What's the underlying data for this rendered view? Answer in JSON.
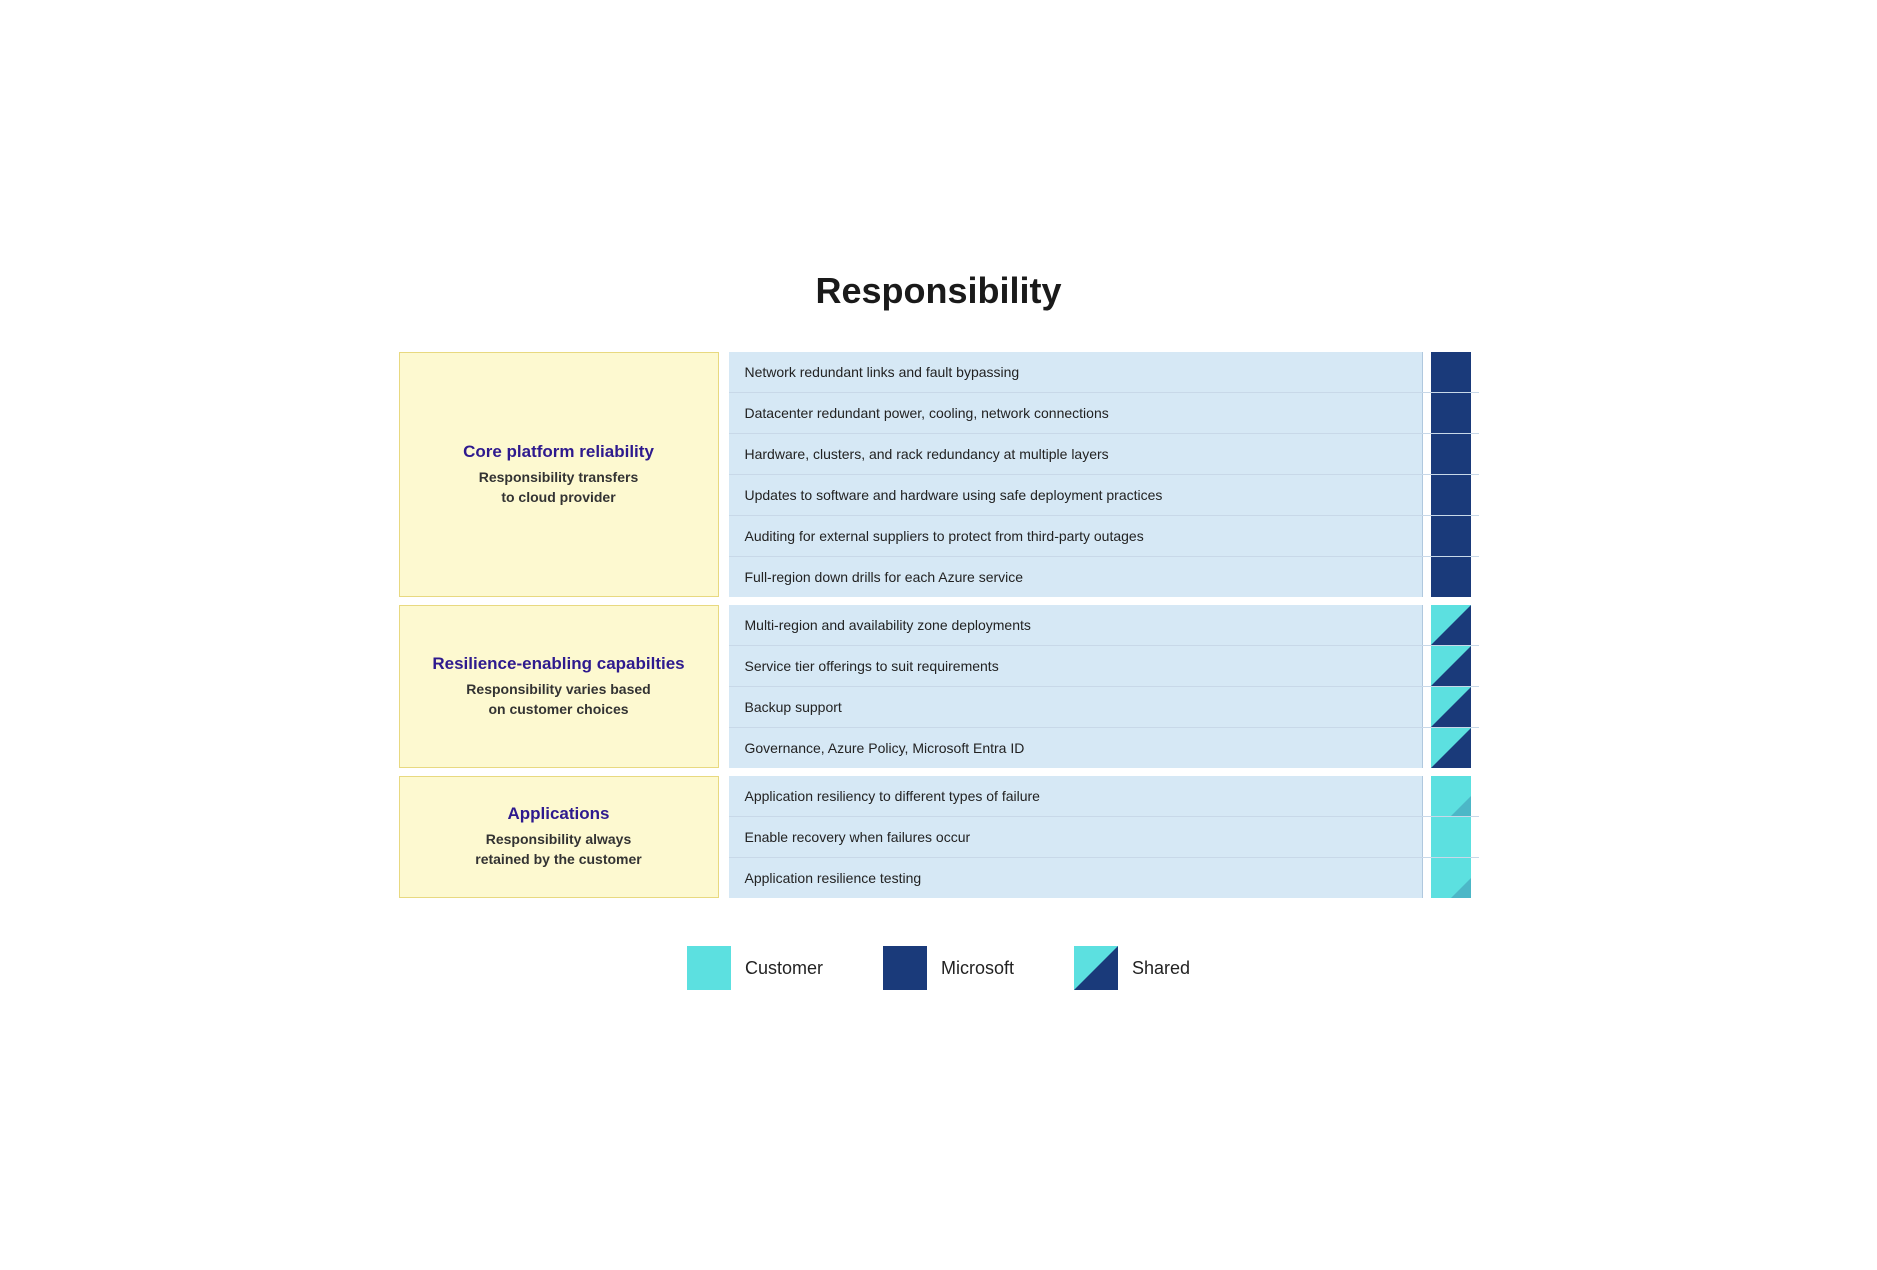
{
  "title": "Responsibility",
  "sections": [
    {
      "id": "core-platform",
      "label_title": "Core platform reliability",
      "label_sub": "Responsibility transfers\nto cloud provider",
      "features": [
        {
          "text": "Network redundant links and fault bypassing",
          "resp": "microsoft"
        },
        {
          "text": "Datacenter redundant power, cooling, network connections",
          "resp": "microsoft"
        },
        {
          "text": "Hardware, clusters, and rack redundancy at multiple layers",
          "resp": "microsoft"
        },
        {
          "text": "Updates to software and hardware using safe deployment practices",
          "resp": "microsoft"
        },
        {
          "text": "Auditing for external suppliers to protect from third-party outages",
          "resp": "microsoft"
        },
        {
          "text": "Full-region down drills for each Azure service",
          "resp": "microsoft"
        }
      ]
    },
    {
      "id": "resilience-enabling",
      "label_title": "Resilience-enabling capabilties",
      "label_sub": "Responsibility varies based\non customer choices",
      "features": [
        {
          "text": "Multi-region and availability zone deployments",
          "resp": "shared"
        },
        {
          "text": "Service tier offerings to suit requirements",
          "resp": "shared"
        },
        {
          "text": "Backup support",
          "resp": "shared"
        },
        {
          "text": "Governance, Azure Policy, Microsoft Entra ID",
          "resp": "shared"
        }
      ]
    },
    {
      "id": "applications",
      "label_title": "Applications",
      "label_sub": "Responsibility always\nretained by the customer",
      "features": [
        {
          "text": "Application resiliency to different types of failure",
          "resp": "customer-shared"
        },
        {
          "text": "Enable recovery when failures occur",
          "resp": "customer"
        },
        {
          "text": "Application resilience testing",
          "resp": "customer-shared"
        }
      ]
    }
  ],
  "legend": {
    "items": [
      {
        "id": "customer",
        "label": "Customer",
        "type": "customer"
      },
      {
        "id": "microsoft",
        "label": "Microsoft",
        "type": "microsoft"
      },
      {
        "id": "shared",
        "label": "Shared",
        "type": "shared"
      }
    ]
  }
}
